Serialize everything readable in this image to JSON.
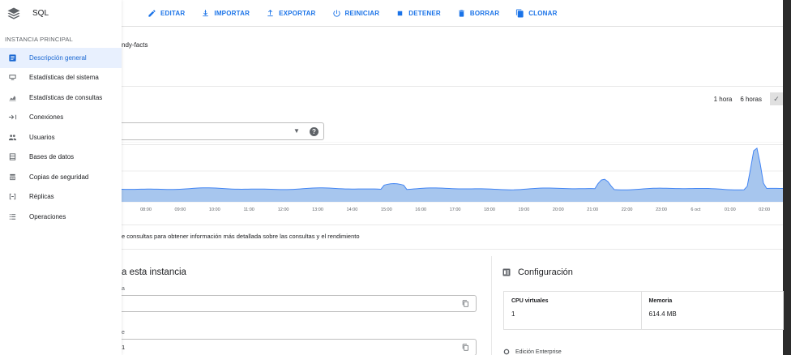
{
  "brand": {
    "title": "SQL"
  },
  "toolbar": {
    "items": [
      {
        "label": "EDITAR",
        "icon": "pencil-icon"
      },
      {
        "label": "IMPORTAR",
        "icon": "import-icon"
      },
      {
        "label": "EXPORTAR",
        "icon": "export-icon"
      },
      {
        "label": "REINICIAR",
        "icon": "power-icon"
      },
      {
        "label": "DETENER",
        "icon": "stop-icon"
      },
      {
        "label": "BORRAR",
        "icon": "trash-icon"
      },
      {
        "label": "CLONAR",
        "icon": "clone-icon"
      }
    ]
  },
  "sidebar": {
    "section": "INSTANCIA PRINCIPAL",
    "items": [
      {
        "label": "Descripción general",
        "icon": "overview-icon",
        "active": true
      },
      {
        "label": "Estadísticas del sistema",
        "icon": "system-insights-icon",
        "active": false
      },
      {
        "label": "Estadísticas de consultas",
        "icon": "query-insights-icon",
        "active": false
      },
      {
        "label": "Conexiones",
        "icon": "connections-icon",
        "active": false
      },
      {
        "label": "Usuarios",
        "icon": "users-icon",
        "active": false
      },
      {
        "label": "Bases de datos",
        "icon": "databases-icon",
        "active": false
      },
      {
        "label": "Copias de seguridad",
        "icon": "backups-icon",
        "active": false
      },
      {
        "label": "Réplicas",
        "icon": "replicas-icon",
        "active": false
      },
      {
        "label": "Operaciones",
        "icon": "operations-icon",
        "active": false
      }
    ]
  },
  "main": {
    "instance_fragment": "ndy-facts",
    "time_range": {
      "options": [
        "1 hora",
        "6 horas"
      ],
      "check": "✓"
    },
    "query_note": "e consultas para obtener información más detallada sobre las consultas y el rendimiento",
    "connect": {
      "title": "a esta instancia",
      "field1_label": "a",
      "field1_value": "",
      "field2_label": "e",
      "field2_value": "1"
    },
    "config": {
      "title": "Configuración",
      "cpu_label": "CPU virtuales",
      "cpu_value": "1",
      "memory_label": "Memoria",
      "memory_value": "614.4 MB",
      "edition": "Edición Enterprise"
    }
  },
  "chart_data": {
    "type": "area",
    "x_labels": [
      "08:00",
      "09:00",
      "10:00",
      "11:00",
      "12:00",
      "13:00",
      "14:00",
      "15:00",
      "16:00",
      "17:00",
      "18:00",
      "19:00",
      "20:00",
      "21:00",
      "22:00",
      "23:00",
      "6 oct",
      "01:00",
      "02:00"
    ],
    "grid": true,
    "legend": "none",
    "fill_color": "#a7c6ee",
    "line_color": "#4285f4"
  }
}
